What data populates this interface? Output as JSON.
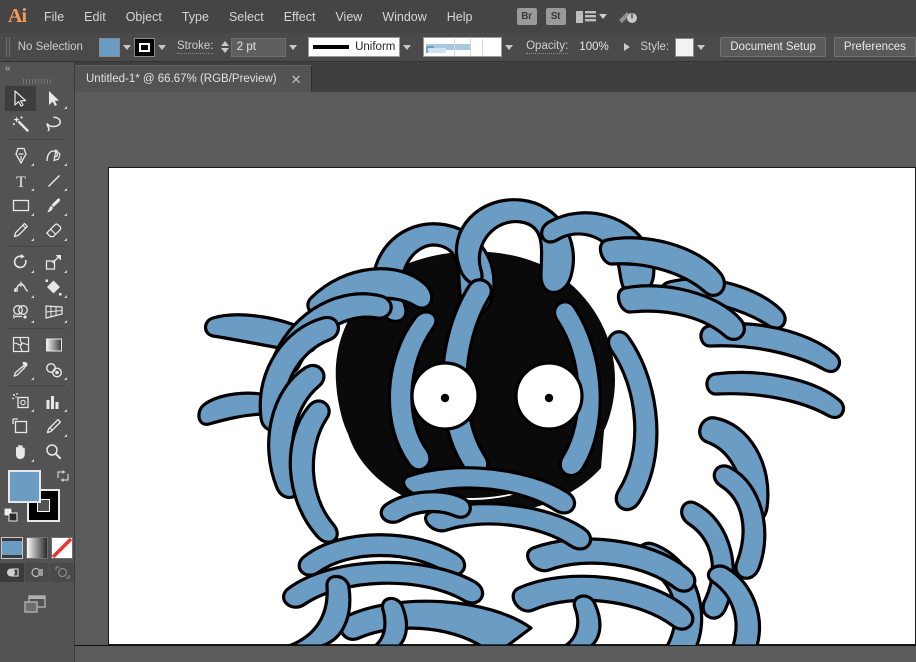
{
  "app": {
    "name": "Adobe Illustrator",
    "logo_text": "Ai"
  },
  "menubar": {
    "items": [
      {
        "label": "File",
        "name": "menu-file"
      },
      {
        "label": "Edit",
        "name": "menu-edit"
      },
      {
        "label": "Object",
        "name": "menu-object"
      },
      {
        "label": "Type",
        "name": "menu-type"
      },
      {
        "label": "Select",
        "name": "menu-select"
      },
      {
        "label": "Effect",
        "name": "menu-effect"
      },
      {
        "label": "View",
        "name": "menu-view"
      },
      {
        "label": "Window",
        "name": "menu-window"
      },
      {
        "label": "Help",
        "name": "menu-help"
      }
    ],
    "bridge_label": "Br",
    "stock_label": "St",
    "workspace_icon": "workspace-switcher-icon",
    "workspace_chevron_icon": "chevron-down-icon",
    "search_icon": "search-adobe-stock-icon"
  },
  "controlbar": {
    "selection_status": "No Selection",
    "fill_label": "fill-swatch",
    "fill_color": "#6b9cc4",
    "stroke_swatch_label": "stroke-swatch",
    "stroke_label": "Stroke:",
    "stroke_weight": "2 pt",
    "stroke_profile": "Uniform",
    "brush_definition": "brush-definition-preview",
    "opacity_label": "Opacity:",
    "opacity_value": "100%",
    "style_label": "Style:",
    "style_swatch": "graphic-style-swatch",
    "document_setup_label": "Document Setup",
    "preferences_label": "Preferences"
  },
  "tabbar": {
    "document_title": "Untitled-1* @ 66.67% (RGB/Preview)",
    "close_glyph": "✕"
  },
  "toolbar": {
    "collapse_glyph": "«",
    "tools": [
      {
        "name": "selection-tool",
        "label": "Selection Tool",
        "active": true,
        "corner": false
      },
      {
        "name": "direct-selection-tool",
        "label": "Direct Selection Tool",
        "active": false,
        "corner": true
      },
      {
        "name": "magic-wand-tool",
        "label": "Magic Wand Tool",
        "active": false,
        "corner": false
      },
      {
        "name": "lasso-tool",
        "label": "Lasso Tool",
        "active": false,
        "corner": false
      },
      {
        "name": "pen-tool",
        "label": "Pen Tool",
        "active": false,
        "corner": true
      },
      {
        "name": "curvature-tool",
        "label": "Curvature Tool",
        "active": false,
        "corner": true
      },
      {
        "name": "type-tool",
        "label": "Type Tool",
        "active": false,
        "corner": true
      },
      {
        "name": "line-segment-tool",
        "label": "Line Segment Tool",
        "active": false,
        "corner": true
      },
      {
        "name": "rectangle-tool",
        "label": "Rectangle Tool",
        "active": false,
        "corner": true
      },
      {
        "name": "paintbrush-tool",
        "label": "Paintbrush Tool",
        "active": false,
        "corner": true
      },
      {
        "name": "pencil-tool",
        "label": "Pencil Tool",
        "active": false,
        "corner": true
      },
      {
        "name": "eraser-tool",
        "label": "Eraser Tool",
        "active": false,
        "corner": true
      },
      {
        "name": "rotate-tool",
        "label": "Rotate Tool",
        "active": false,
        "corner": true
      },
      {
        "name": "scale-tool",
        "label": "Scale Tool",
        "active": false,
        "corner": true
      },
      {
        "name": "width-tool",
        "label": "Width Tool",
        "active": false,
        "corner": true
      },
      {
        "name": "free-transform-tool",
        "label": "Free Transform Tool",
        "active": false,
        "corner": true
      },
      {
        "name": "shape-builder-tool",
        "label": "Shape Builder Tool",
        "active": false,
        "corner": true
      },
      {
        "name": "perspective-grid-tool",
        "label": "Perspective Grid Tool",
        "active": false,
        "corner": true
      },
      {
        "name": "mesh-tool",
        "label": "Mesh Tool",
        "active": false,
        "corner": false
      },
      {
        "name": "gradient-tool",
        "label": "Gradient Tool",
        "active": false,
        "corner": false
      },
      {
        "name": "eyedropper-tool",
        "label": "Eyedropper Tool",
        "active": false,
        "corner": true
      },
      {
        "name": "blend-tool",
        "label": "Blend Tool",
        "active": false,
        "corner": true
      },
      {
        "name": "symbol-sprayer-tool",
        "label": "Symbol Sprayer Tool",
        "active": false,
        "corner": true
      },
      {
        "name": "column-graph-tool",
        "label": "Column Graph Tool",
        "active": false,
        "corner": true
      },
      {
        "name": "artboard-tool",
        "label": "Artboard Tool",
        "active": false,
        "corner": false
      },
      {
        "name": "slice-tool",
        "label": "Slice Tool",
        "active": false,
        "corner": true
      },
      {
        "name": "hand-tool",
        "label": "Hand Tool",
        "active": false,
        "corner": true
      },
      {
        "name": "zoom-tool",
        "label": "Zoom Tool",
        "active": false,
        "corner": false
      }
    ],
    "fill_color": "#6b9cc4",
    "stroke_color": "#000000",
    "swap_icon": "swap-fill-stroke-icon",
    "default_icon": "default-fill-stroke-icon",
    "modes": [
      {
        "name": "color-mode-button",
        "label": "Color",
        "selected": true
      },
      {
        "name": "gradient-mode-button",
        "label": "Gradient",
        "selected": false
      },
      {
        "name": "none-mode-button",
        "label": "None",
        "selected": false
      }
    ],
    "draw_modes": [
      {
        "name": "draw-normal-button",
        "label": "Draw Normal",
        "selected": true
      },
      {
        "name": "draw-behind-button",
        "label": "Draw Behind",
        "selected": false
      },
      {
        "name": "draw-inside-button",
        "label": "Draw Inside",
        "selected": false
      }
    ],
    "screen_mode": "change-screen-mode-button"
  },
  "artwork": {
    "name": "tangela-vine-creature-illustration",
    "vine_color": "#6b9cc4",
    "face_color": "#0a0a0a",
    "eye_color": "#ffffff",
    "pupil_color": "#000000",
    "outline_color": "#000000"
  }
}
